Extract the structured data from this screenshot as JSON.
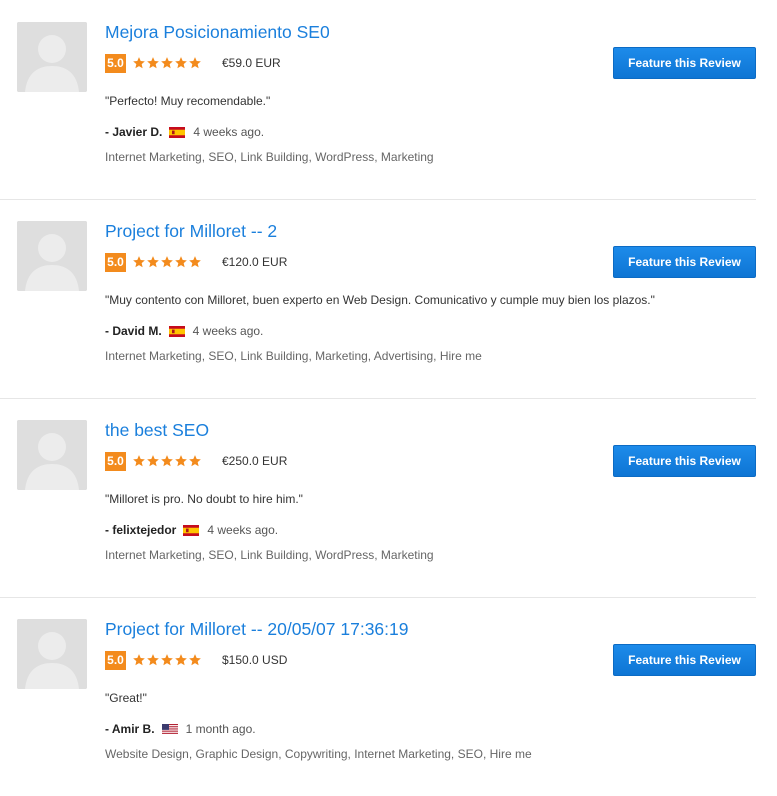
{
  "feature_button_label": "Feature this Review",
  "colors": {
    "accent": "#1a7fdc",
    "score_badge": "#f38b1d",
    "star": "#f38b1d",
    "button": "#1085e0"
  },
  "reviews": [
    {
      "title": "Mejora Posicionamiento SE0",
      "score": "5.0",
      "stars": 5,
      "price": "€59.0 EUR",
      "quote": "\"Perfecto! Muy recomendable.\"",
      "reviewer": "- Javier D.",
      "flag": "spain-flag-icon",
      "time": "4 weeks ago.",
      "tags": "Internet Marketing, SEO, Link Building, WordPress, Marketing"
    },
    {
      "title": "Project for Milloret -- 2",
      "score": "5.0",
      "stars": 5,
      "price": "€120.0 EUR",
      "quote": "\"Muy contento con Milloret, buen experto en Web Design. Comunicativo y cumple muy bien los plazos.\"",
      "reviewer": "- David M.",
      "flag": "spain-flag-icon",
      "time": "4 weeks ago.",
      "tags": "Internet Marketing, SEO, Link Building, Marketing, Advertising, Hire me"
    },
    {
      "title": "the best SEO",
      "score": "5.0",
      "stars": 5,
      "price": "€250.0 EUR",
      "quote": "\"Milloret is pro. No doubt to hire him.\"",
      "reviewer": "- felixtejedor",
      "flag": "spain-flag-icon",
      "time": "4 weeks ago.",
      "tags": "Internet Marketing, SEO, Link Building, WordPress, Marketing"
    },
    {
      "title": "Project for Milloret -- 20/05/07 17:36:19",
      "score": "5.0",
      "stars": 5,
      "price": "$150.0 USD",
      "quote": "\"Great!\"",
      "reviewer": "- Amir B.",
      "flag": "us-flag-icon",
      "time": "1 month ago.",
      "tags": "Website Design, Graphic Design, Copywriting, Internet Marketing, SEO, Hire me"
    }
  ]
}
